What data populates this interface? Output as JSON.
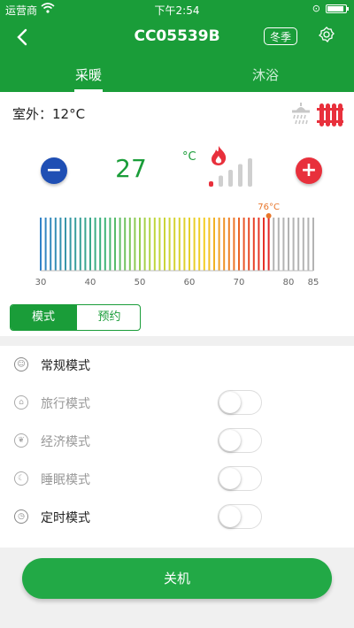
{
  "status_bar": {
    "carrier": "运营商",
    "time": "下午2:54",
    "battery_level": 0.9
  },
  "nav": {
    "title": "CC05539B",
    "season_label": "冬季"
  },
  "tabs": [
    {
      "label": "采暖",
      "active": true
    },
    {
      "label": "沐浴",
      "active": false
    }
  ],
  "outdoor": {
    "label": "室外：12°C"
  },
  "control": {
    "target_temp": "27",
    "unit": "°C",
    "minus_symbol": "−",
    "plus_symbol": "+",
    "flame_level": 1,
    "level_count": 5
  },
  "scale": {
    "min": 30,
    "max": 85,
    "current": 76,
    "current_label": "76°C",
    "tick_labels": [
      "30",
      "40",
      "50",
      "60",
      "70",
      "80",
      "85"
    ]
  },
  "segments": [
    {
      "label": "模式",
      "active": true
    },
    {
      "label": "预约",
      "active": false
    }
  ],
  "modes": [
    {
      "label": "常规模式",
      "icon": "smiley-icon",
      "glyph": "☺",
      "has_toggle": false,
      "on": true
    },
    {
      "label": "旅行模式",
      "icon": "luggage-icon",
      "glyph": "⌂",
      "has_toggle": true,
      "on": false
    },
    {
      "label": "经济模式",
      "icon": "leaf-icon",
      "glyph": "❦",
      "has_toggle": true,
      "on": false
    },
    {
      "label": "睡眠模式",
      "icon": "moon-icon",
      "glyph": "☾",
      "has_toggle": true,
      "on": false
    },
    {
      "label": "定时模式",
      "icon": "clock-icon",
      "glyph": "◷",
      "has_toggle": true,
      "on": false
    }
  ],
  "power_button": {
    "label": "关机"
  },
  "colors": {
    "primary": "#1a9d39",
    "minus": "#1f4fb4",
    "plus": "#e8303c",
    "current_marker": "#e8762b",
    "inactive_bar": "#b3b3b3"
  }
}
